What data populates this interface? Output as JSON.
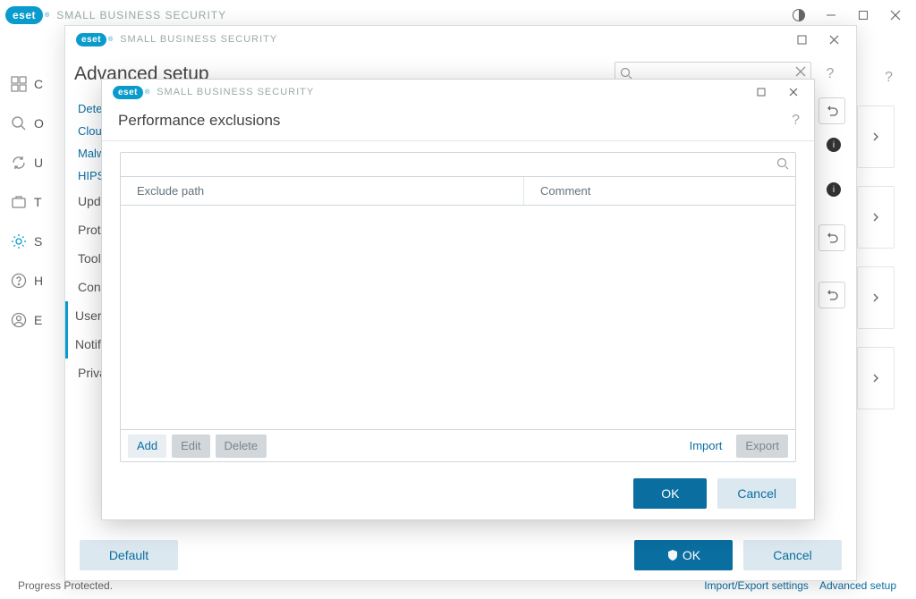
{
  "brand": {
    "pill": "eset",
    "product": "SMALL BUSINESS SECURITY"
  },
  "bg": {
    "status": "Progress  Protected.",
    "footer_import": "Import/Export settings",
    "footer_adv": "Advanced setup",
    "nav_letters": [
      "C",
      "O",
      "U",
      "T",
      "S",
      "H",
      "E"
    ]
  },
  "adv": {
    "title": "Advanced setup",
    "search_placeholder": "",
    "sidebar": {
      "links": [
        "Detec",
        "Cloud",
        "Malwa",
        "HIPS"
      ],
      "items": [
        "Update",
        "Protections",
        "Tools",
        "Connections",
        "User interface",
        "Notifications",
        "Privacy"
      ]
    },
    "footer": {
      "default": "Default",
      "ok": "OK",
      "cancel": "Cancel"
    }
  },
  "perf": {
    "title": "Performance exclusions",
    "cols": {
      "path": "Exclude path",
      "comment": "Comment"
    },
    "buttons": {
      "add": "Add",
      "edit": "Edit",
      "delete": "Delete",
      "import": "Import",
      "export": "Export"
    },
    "footer": {
      "ok": "OK",
      "cancel": "Cancel"
    }
  }
}
